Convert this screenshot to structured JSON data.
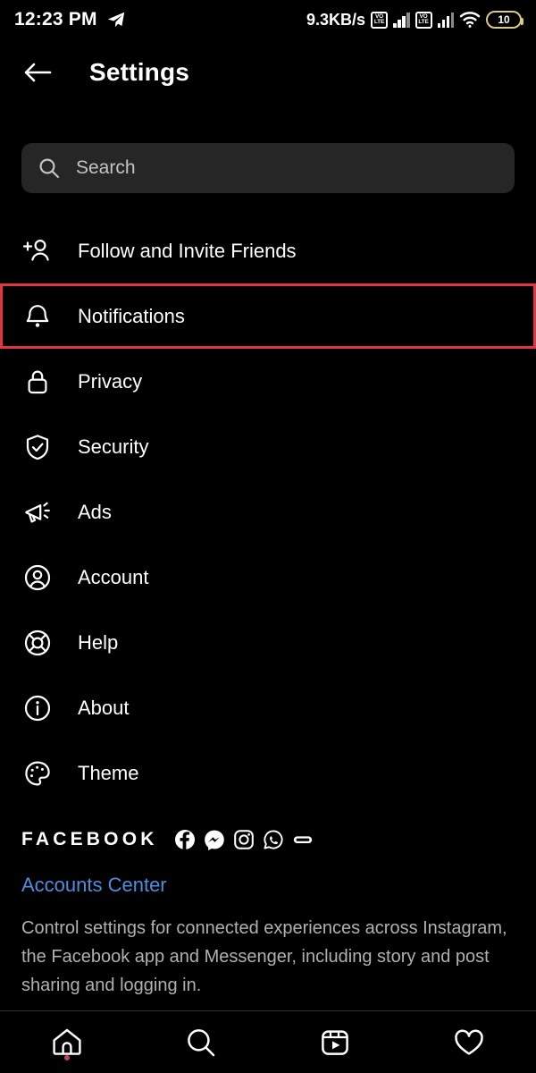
{
  "statusbar": {
    "time": "12:23 PM",
    "app_icon": "telegram-icon",
    "network_speed": "9.3KB/s",
    "sim1_label_top": "VO",
    "sim1_label_bottom": "LTE",
    "sim2_label_top": "VO",
    "sim2_label_bottom": "LTE",
    "wifi_icon": "wifi-icon",
    "battery_level": "10"
  },
  "header": {
    "back_icon": "back-arrow-icon",
    "title": "Settings"
  },
  "search": {
    "icon": "search-icon",
    "placeholder": "Search",
    "value": ""
  },
  "menu": {
    "items": [
      {
        "label": "Follow and Invite Friends",
        "icon": "add-person-icon",
        "highlighted": false
      },
      {
        "label": "Notifications",
        "icon": "bell-icon",
        "highlighted": true
      },
      {
        "label": "Privacy",
        "icon": "lock-icon",
        "highlighted": false
      },
      {
        "label": "Security",
        "icon": "shield-check-icon",
        "highlighted": false
      },
      {
        "label": "Ads",
        "icon": "megaphone-icon",
        "highlighted": false
      },
      {
        "label": "Account",
        "icon": "account-circle-icon",
        "highlighted": false
      },
      {
        "label": "Help",
        "icon": "life-ring-icon",
        "highlighted": false
      },
      {
        "label": "About",
        "icon": "info-circle-icon",
        "highlighted": false
      },
      {
        "label": "Theme",
        "icon": "palette-icon",
        "highlighted": false
      }
    ]
  },
  "facebook_section": {
    "wordmark": "FACEBOOK",
    "brand_icons": [
      "facebook-icon",
      "messenger-icon",
      "instagram-icon",
      "whatsapp-icon",
      "portal-icon"
    ],
    "accounts_center_label": "Accounts Center",
    "description": "Control settings for connected experiences across Instagram, the Facebook app and Messenger, including story and post sharing and logging in."
  },
  "bottom_nav": {
    "items": [
      {
        "icon": "home-icon",
        "has_dot": true
      },
      {
        "icon": "search-icon",
        "has_dot": false
      },
      {
        "icon": "reels-icon",
        "has_dot": false
      },
      {
        "icon": "heart-icon",
        "has_dot": false
      }
    ]
  },
  "colors": {
    "background": "#000000",
    "highlight": "#e23544",
    "link": "#4a8fe0",
    "search_field": "#262626",
    "muted_text": "#b0b0b0"
  }
}
